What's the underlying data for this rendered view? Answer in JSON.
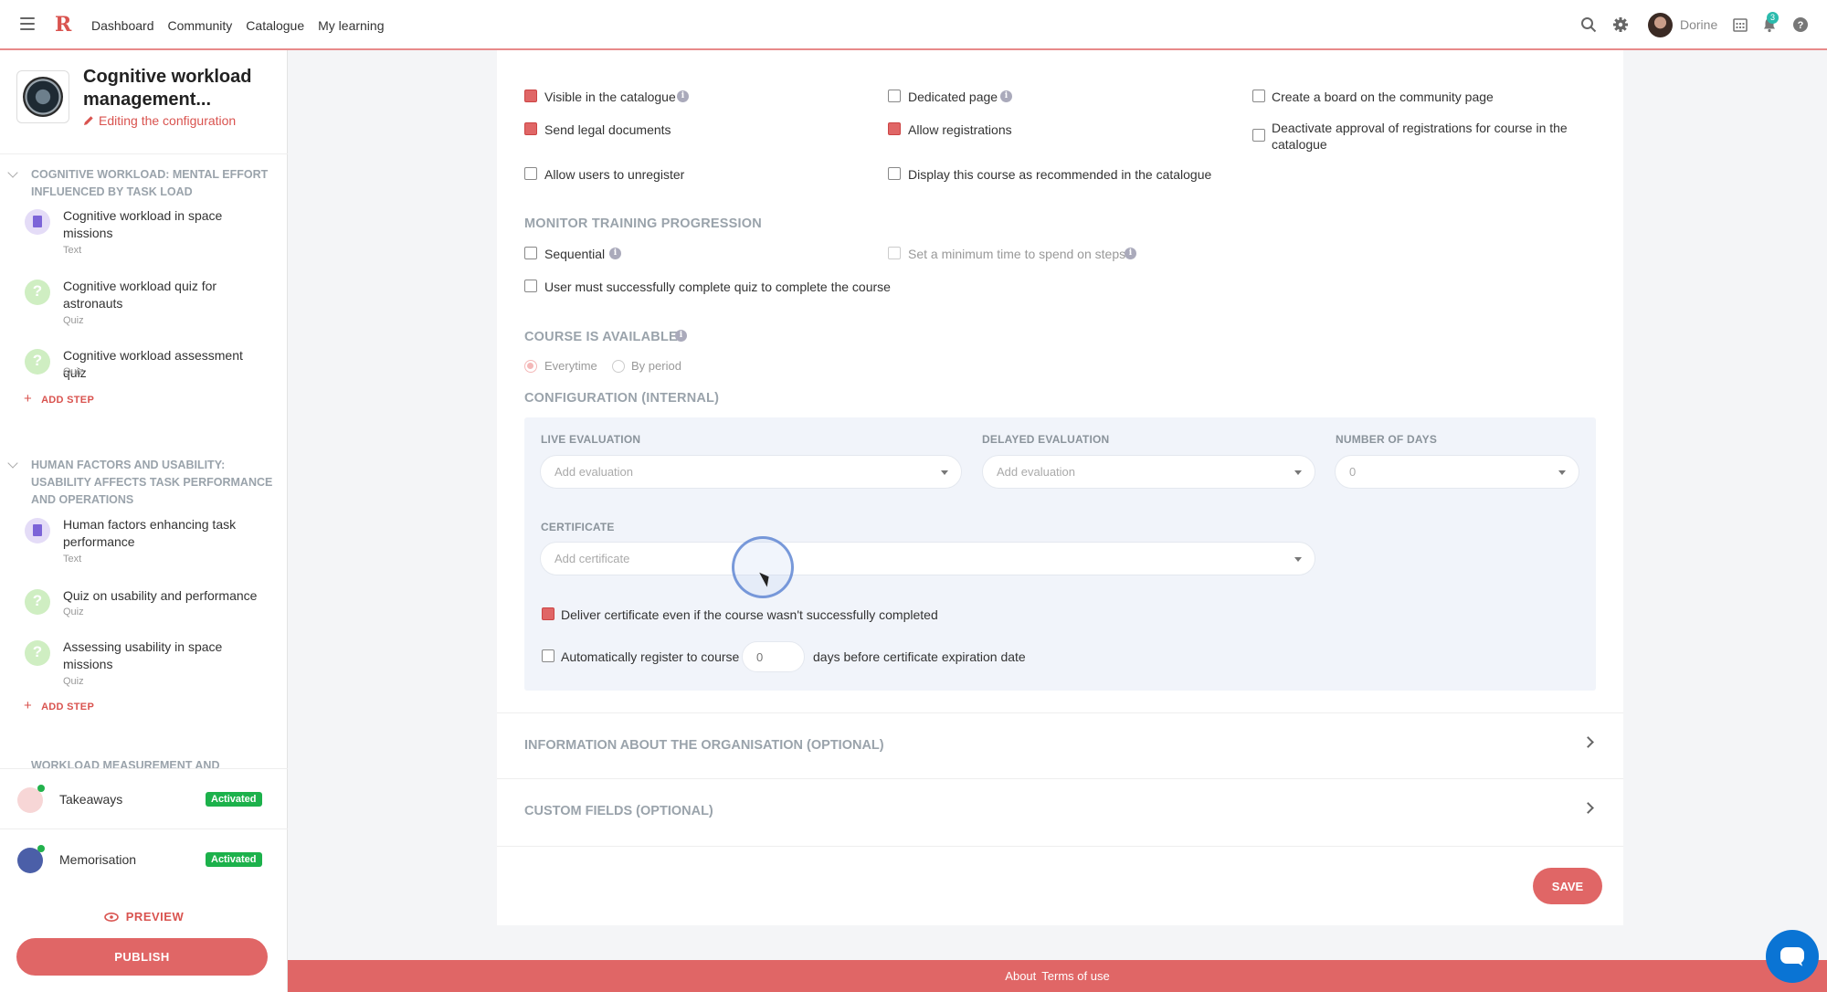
{
  "topnav": {
    "items": [
      "Dashboard",
      "Community",
      "Catalogue",
      "My learning"
    ],
    "user_name": "Dorine",
    "notification_count": "3"
  },
  "course": {
    "title": "Cognitive workload management...",
    "editing_label": "Editing the configuration"
  },
  "sidebar": {
    "sections": [
      {
        "title": "COGNITIVE WORKLOAD: MENTAL EFFORT INFLUENCED BY TASK LOAD",
        "steps": [
          {
            "title": "Cognitive workload in space missions",
            "type": "Text"
          },
          {
            "title": "Cognitive workload quiz for astronauts",
            "type": "Quiz"
          },
          {
            "title": "Cognitive workload assessment quiz",
            "type": "Quiz"
          }
        ],
        "add_step": "ADD STEP"
      },
      {
        "title": "HUMAN FACTORS AND USABILITY: USABILITY AFFECTS TASK PERFORMANCE AND OPERATIONS",
        "steps": [
          {
            "title": "Human factors enhancing task performance",
            "type": "Text"
          },
          {
            "title": "Quiz on usability and performance",
            "type": "Quiz"
          },
          {
            "title": "Assessing usability in space missions",
            "type": "Quiz"
          }
        ],
        "add_step": "ADD STEP"
      },
      {
        "title": "WORKLOAD MEASUREMENT AND"
      }
    ],
    "modules": [
      {
        "label": "Takeaways",
        "status": "Activated"
      },
      {
        "label": "Memorisation",
        "status": "Activated"
      }
    ],
    "preview_label": "PREVIEW",
    "publish_label": "PUBLISH"
  },
  "settings": {
    "options": [
      {
        "label": "Visible in the catalogue",
        "checked": true
      },
      {
        "label": "Dedicated page",
        "checked": false
      },
      {
        "label": "Create a board on the community page",
        "checked": false
      },
      {
        "label": "Send legal documents",
        "checked": true
      },
      {
        "label": "Allow registrations",
        "checked": true
      },
      {
        "label": "Deactivate approval of registrations for course in the catalogue",
        "checked": false
      },
      {
        "label": "Allow users to unregister",
        "checked": false
      },
      {
        "label": "Display this course as recommended in the catalogue",
        "checked": false
      }
    ],
    "monitor_heading": "MONITOR TRAINING PROGRESSION",
    "sequential_label": "Sequential",
    "min_time_label": "Set a minimum time to spend on steps",
    "quiz_required_label": "User must successfully complete quiz to complete the course",
    "available_heading": "COURSE IS AVAILABLE",
    "availability": {
      "options": [
        "Everytime",
        "By period"
      ],
      "selected": "Everytime"
    },
    "config_heading": "CONFIGURATION (INTERNAL)",
    "live_eval_label": "LIVE EVALUATION",
    "live_eval_placeholder": "Add evaluation",
    "delayed_eval_label": "DELAYED EVALUATION",
    "delayed_eval_placeholder": "Add evaluation",
    "days_label": "NUMBER OF DAYS",
    "days_value": "0",
    "certificate_label": "CERTIFICATE",
    "certificate_placeholder": "Add certificate",
    "deliver_label": "Deliver certificate even if the course wasn't successfully completed",
    "auto_register_label": "Automatically register to course",
    "auto_register_days": "0",
    "auto_register_suffix": "days before certificate expiration date",
    "org_info_label": "INFORMATION ABOUT THE ORGANISATION (OPTIONAL)",
    "custom_fields_label": "CUSTOM FIELDS (OPTIONAL)",
    "save_label": "SAVE"
  },
  "footer": {
    "about": "About",
    "terms": "Terms of use"
  },
  "colors": {
    "accent": "#e06666",
    "activated": "#1cb14b",
    "muted_heading": "#9aa3ab"
  }
}
